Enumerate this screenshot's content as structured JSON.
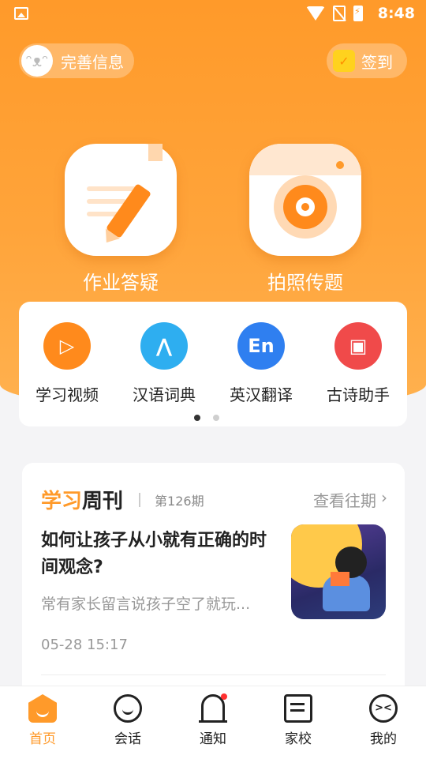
{
  "status_bar": {
    "time": "8:48"
  },
  "header": {
    "profile_label": "完善信息",
    "checkin_label": "签到"
  },
  "main_actions": [
    {
      "label": "作业答疑"
    },
    {
      "label": "拍照传题"
    }
  ],
  "tools": [
    {
      "label": "学习视频",
      "color": "#ff8a1c"
    },
    {
      "label": "汉语词典",
      "color": "#2eaef0"
    },
    {
      "label": "英汉翻译",
      "color": "#2f7ff0",
      "icon_text": "En"
    },
    {
      "label": "古诗助手",
      "color": "#f04a4a"
    }
  ],
  "pager": {
    "pages": 2,
    "active": 0
  },
  "weekly": {
    "title_part1": "学习",
    "title_part2": "周刊",
    "issue": "第126期",
    "more_label": "查看往期",
    "article": {
      "title": "如何让孩子从小就有正确的时间观念?",
      "summary": "常有家长留言说孩子空了就玩...",
      "time": "05-28 15:17"
    }
  },
  "tabbar": {
    "items": [
      {
        "label": "首页",
        "active": true
      },
      {
        "label": "会话"
      },
      {
        "label": "通知",
        "badge": true
      },
      {
        "label": "家校"
      },
      {
        "label": "我的"
      }
    ]
  },
  "colors": {
    "accent": "#ff9a2a"
  }
}
